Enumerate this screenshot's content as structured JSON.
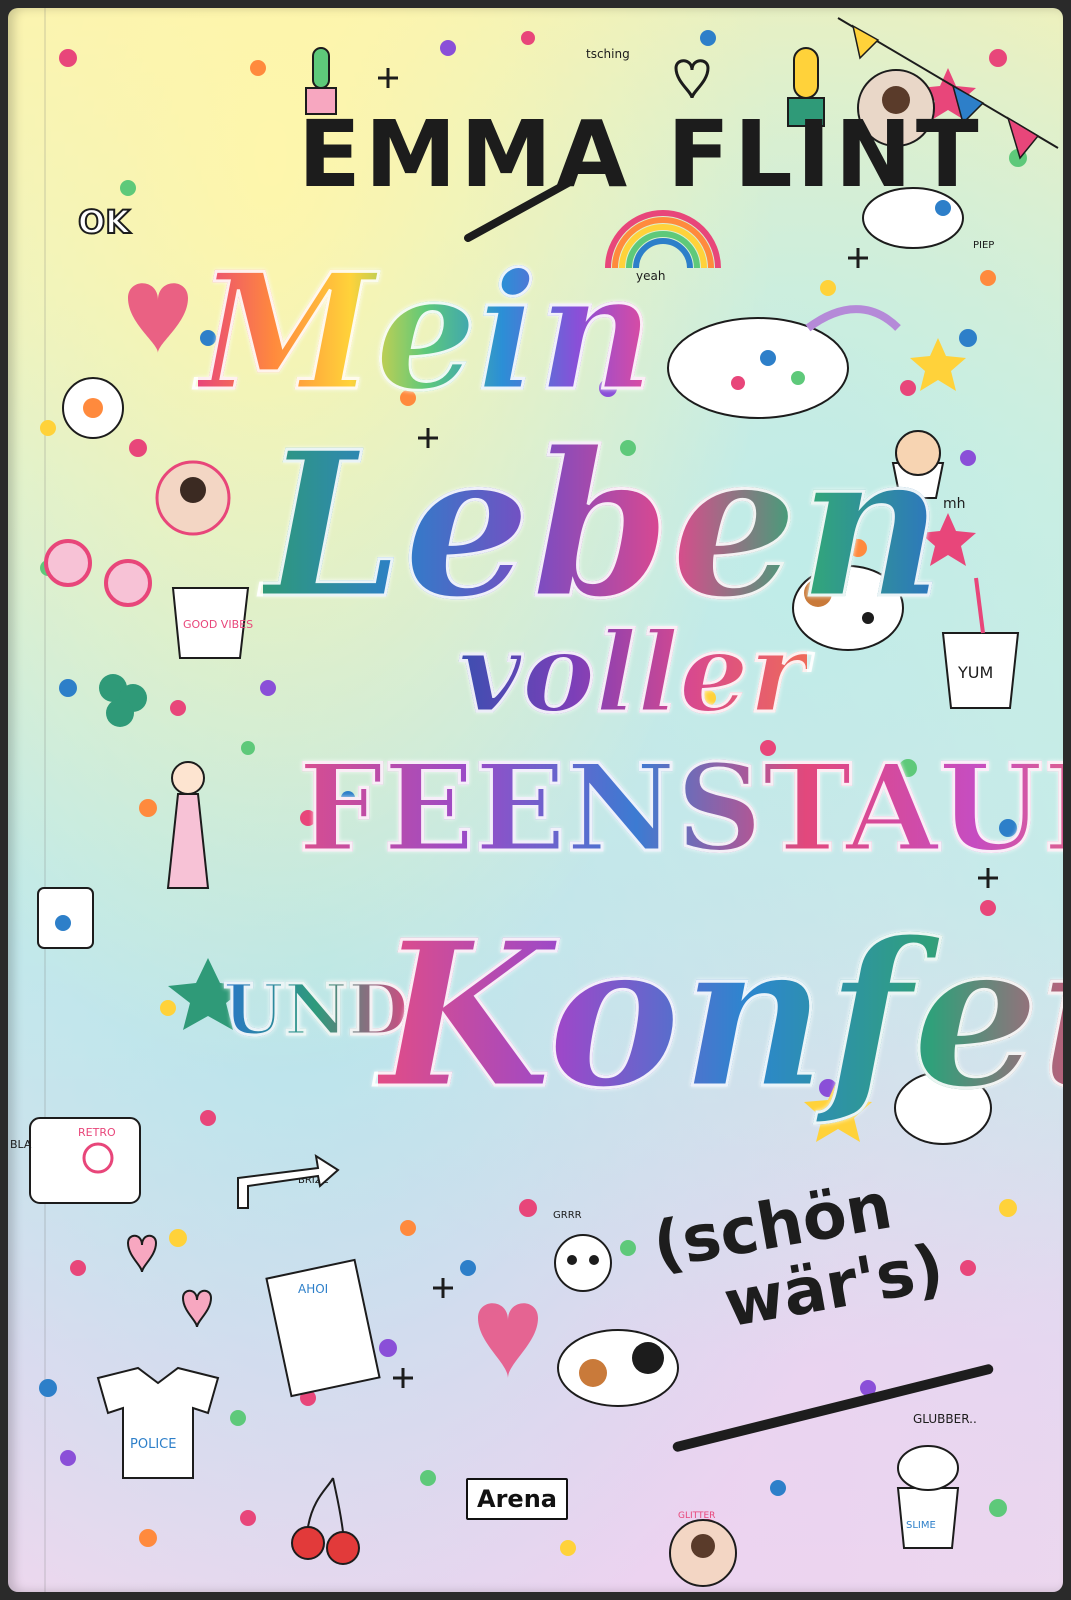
{
  "book": {
    "author": "EMMA FLINT",
    "title": {
      "line1": "Mein",
      "line2": "Leben",
      "line3": "voller",
      "line4": "FEENSTAUB",
      "line5": "UND",
      "line6": "Konfetti"
    },
    "subtitle": {
      "line1": "(schön",
      "line2": "wär's)"
    },
    "publisher": "Arena"
  },
  "doodle_labels": {
    "good_vibes": "GOOD VIBES",
    "yum": "YUM",
    "yeah": "yeah",
    "piep": "PIEP",
    "tsching": "tsching",
    "mh": "mh",
    "police": "POLICE",
    "retro": "RETRO",
    "glubber": "GLUBBER..",
    "slime": "SLIME",
    "glitter": "GLITTER",
    "ahoi": "AHOI",
    "ok": "OK",
    "grrr": "GRRR",
    "brizz": "BRIZZ",
    "bla": "BLA"
  },
  "colors": {
    "ink": "#1c1c1c",
    "pink": "#e8467a",
    "teal": "#2f9a78",
    "blue": "#2d7fc9",
    "purple": "#8a4fd8",
    "yellow": "#ffd23a",
    "orange": "#ff8a3d"
  }
}
